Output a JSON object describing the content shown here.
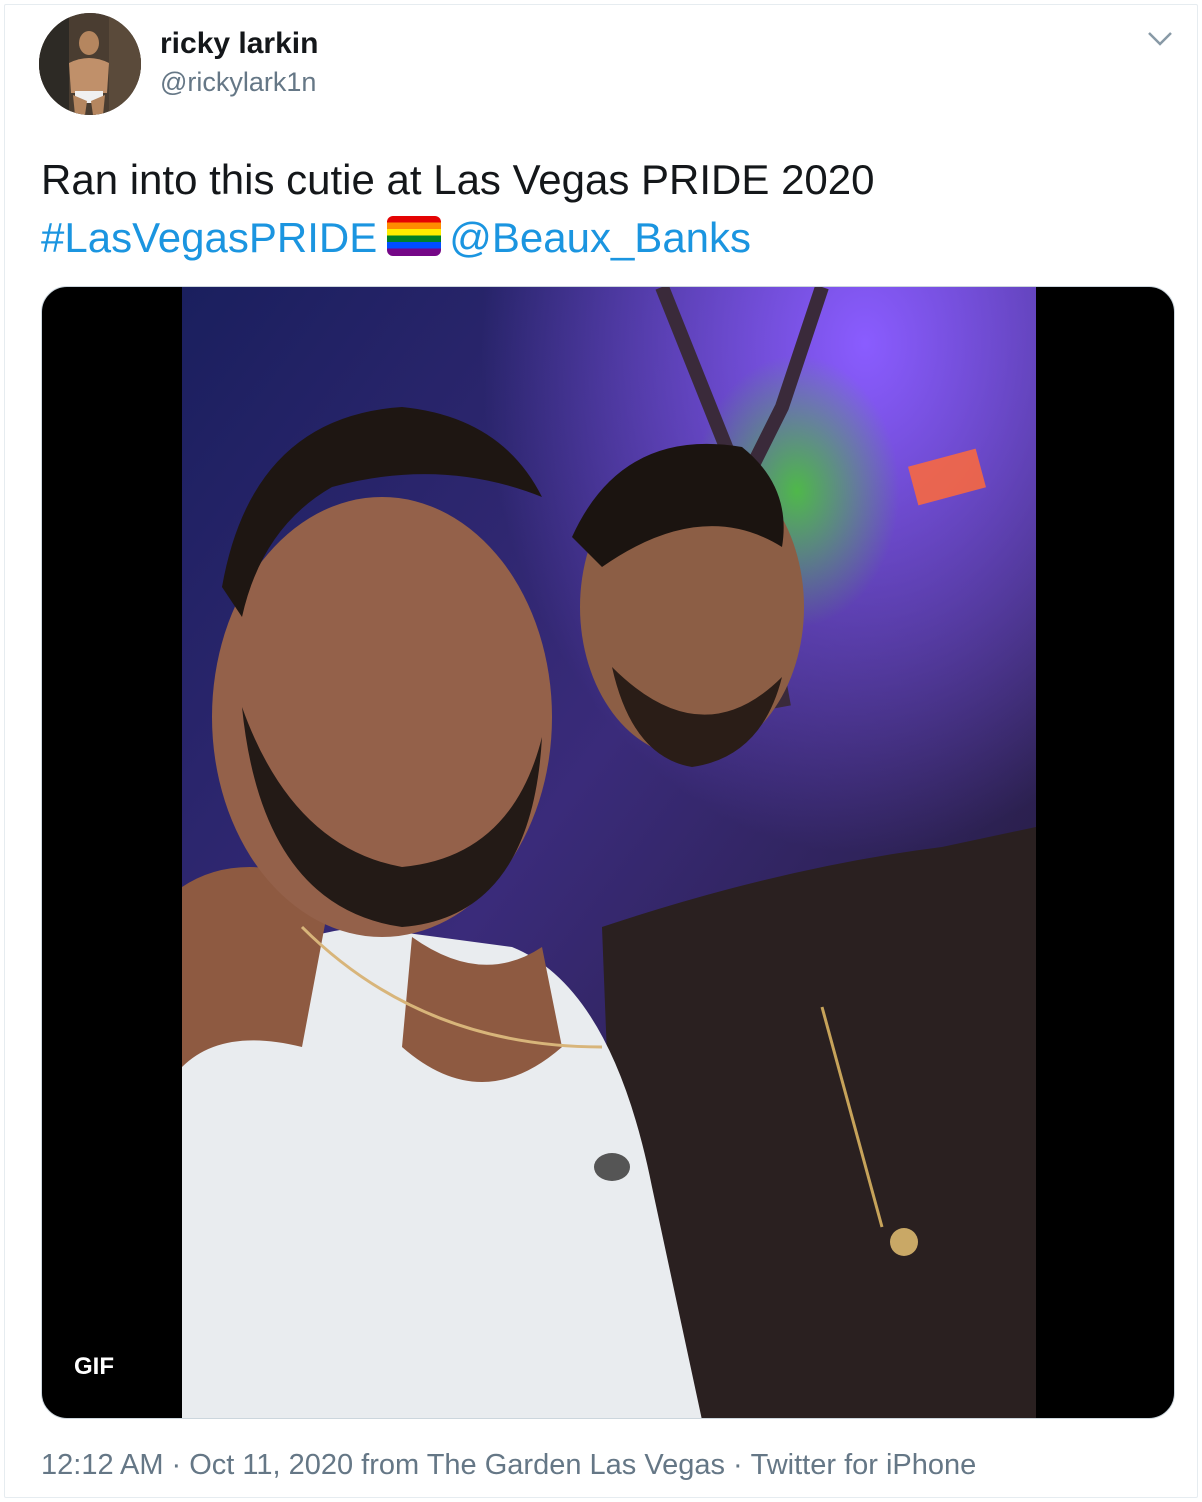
{
  "author": {
    "display_name": "ricky larkin",
    "handle": "@rickylark1n"
  },
  "tweet": {
    "text_line1": "Ran into this cutie at Las Vegas PRIDE 2020",
    "hashtag": "#LasVegasPRIDE",
    "mention": "@Beaux_Banks",
    "flag_emoji": "rainbow-flag",
    "link_color": "#1b95e0"
  },
  "media": {
    "badge": "GIF",
    "description_icon": "gif-player"
  },
  "meta": {
    "time": "12:12 AM",
    "separator": "·",
    "date_place": "Oct 11, 2020 from The Garden Las Vegas",
    "client": "Twitter for iPhone"
  }
}
